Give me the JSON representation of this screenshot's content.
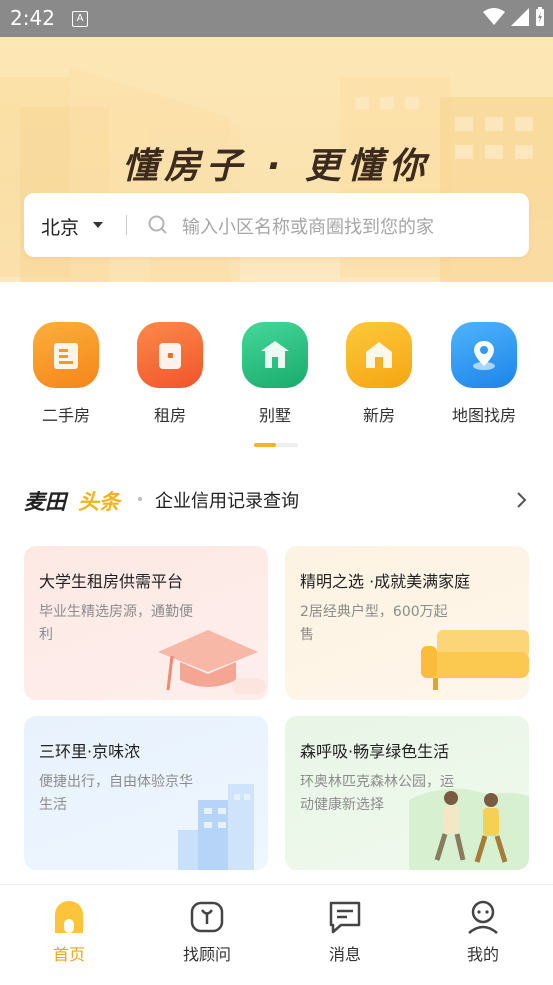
{
  "status_bar": {
    "time": "2:42",
    "a_label": "A"
  },
  "hero": {
    "slogan": "懂房子 · 更懂你"
  },
  "search": {
    "city": "北京",
    "placeholder": "输入小区名称或商圈找到您的家"
  },
  "categories": [
    {
      "label": "二手房",
      "icon": "building-icon",
      "color": "#f79a1e"
    },
    {
      "label": "租房",
      "icon": "room-icon",
      "color": "#f66b2a"
    },
    {
      "label": "别墅",
      "icon": "villa-icon",
      "color": "#27c384"
    },
    {
      "label": "新房",
      "icon": "house-icon",
      "color": "#f8b21c"
    },
    {
      "label": "地图找房",
      "icon": "map-pin-icon",
      "color": "#2f9bf0"
    }
  ],
  "news": {
    "logo_part1": "麦田",
    "logo_part2": "头条",
    "text": "企业信用记录查询"
  },
  "cards": [
    {
      "title": "大学生租房供需平台",
      "desc": "毕业生精选房源，通勤便利"
    },
    {
      "title": "精明之选 ·成就美满家庭",
      "desc": "2居经典户型，600万起售"
    },
    {
      "title": "三环里·京味浓",
      "desc": "便捷出行，自由体验京华生活"
    },
    {
      "title": "森呼吸·畅享绿色生活",
      "desc": "环奥林匹克森林公园，运动健康新选择"
    }
  ],
  "tabs": [
    {
      "label": "首页",
      "icon": "home-icon",
      "active": true
    },
    {
      "label": "找顾问",
      "icon": "advisor-icon",
      "active": false
    },
    {
      "label": "消息",
      "icon": "message-icon",
      "active": false
    },
    {
      "label": "我的",
      "icon": "profile-icon",
      "active": false
    }
  ],
  "colors": {
    "accent": "#f0a519",
    "hero_bg": "#fde7b5"
  }
}
